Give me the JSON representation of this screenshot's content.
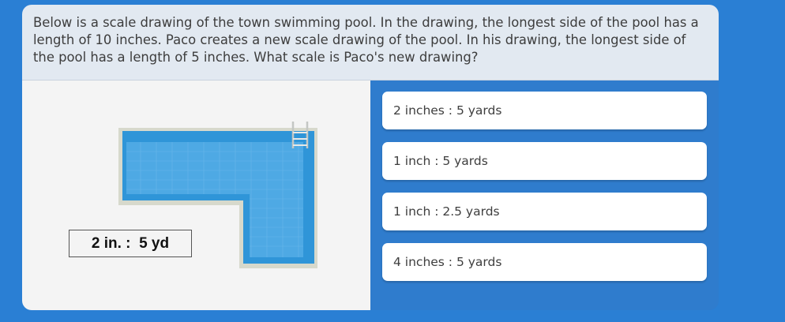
{
  "question": {
    "text": "Below is a scale drawing of the town swimming pool. In the drawing, the longest side of the pool has a length of 10 inches. Paco creates a new scale drawing of the pool. In his drawing, the longest side of the pool has a length of 5 inches. What scale is Paco's new drawing?"
  },
  "figure": {
    "scale_label": "2 in. :  5 yd",
    "pool_icon": "l-shaped-pool-with-ladder"
  },
  "answers": [
    {
      "label": "2 inches : 5 yards"
    },
    {
      "label": "1 inch : 5 yards"
    },
    {
      "label": "1 inch : 2.5 yards"
    },
    {
      "label": "4 inches : 5 yards"
    }
  ],
  "colors": {
    "background": "#2a7fd4",
    "question_bg": "#e2e9f1",
    "figure_bg": "#f4f4f4",
    "pool_water": "#2f95d8",
    "pool_deck": "#d7d9cc"
  }
}
